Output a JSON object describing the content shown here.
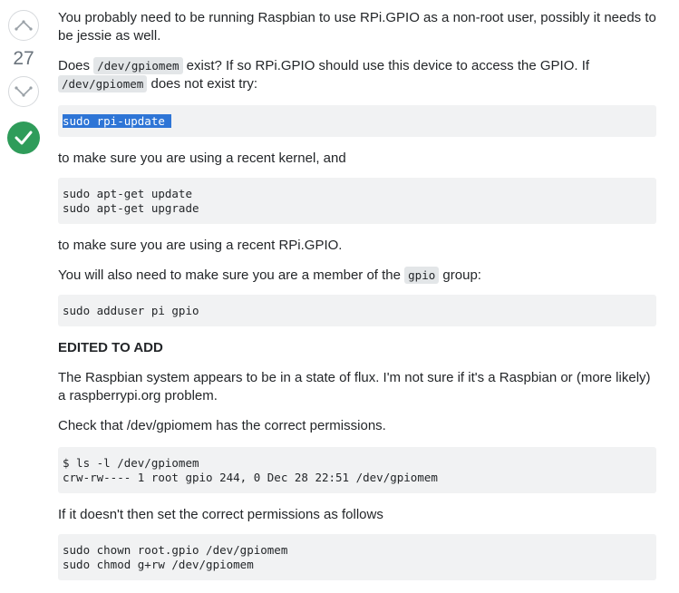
{
  "votes": {
    "count": "27"
  },
  "post": {
    "p1": "You probably need to be running Raspbian to use RPi.GPIO as a non-root user, possibly it needs to be jessie as well.",
    "p2": {
      "a": "Does ",
      "code1": "/dev/gpiomem",
      "b": " exist? If so RPi.GPIO should use this device to access the GPIO. If ",
      "code2": "/dev/gpiomem",
      "c": " does not exist try:"
    },
    "code_update": "sudo rpi-update ",
    "p3": "to make sure you are using a recent kernel, and",
    "code_apt": "sudo apt-get update\nsudo apt-get upgrade",
    "p4": "to make sure you are using a recent RPi.GPIO.",
    "p5": {
      "a": "You will also need to make sure you are a member of the ",
      "code": "gpio",
      "b": " group:"
    },
    "code_adduser": "sudo adduser pi gpio",
    "edited_heading": "EDITED TO ADD",
    "p6": "The Raspbian system appears to be in a state of flux. I'm not sure if it's a Raspbian or (more likely) a raspberrypi.org problem.",
    "p7": "Check that /dev/gpiomem has the correct permissions.",
    "code_ls": "$ ls -l /dev/gpiomem\ncrw-rw---- 1 root gpio 244, 0 Dec 28 22:51 /dev/gpiomem",
    "p8": "If it doesn't then set the correct permissions as follows",
    "code_chown": "sudo chown root.gpio /dev/gpiomem\nsudo chmod g+rw /dev/gpiomem"
  },
  "colors": {
    "accepted": "#2f9c5a",
    "selection": "#2e75d6",
    "code_bg": "#f1f2f3"
  },
  "icons": {
    "upvote": "up-arrow-icon",
    "downvote": "down-arrow-icon",
    "accepted": "checkmark-icon"
  }
}
